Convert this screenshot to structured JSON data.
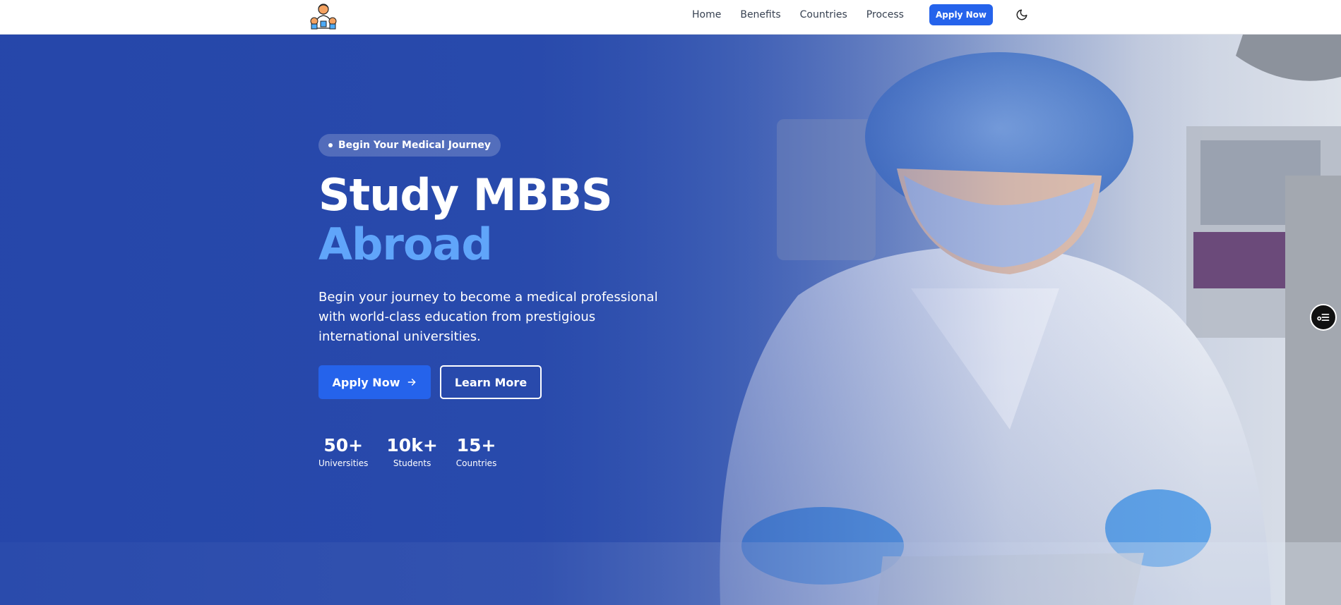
{
  "nav": {
    "logo_icon": "doctor-mascot-logo-icon",
    "links": [
      "Home",
      "Benefits",
      "Countries",
      "Process"
    ],
    "cta_label": "Apply Now",
    "theme_icon": "moon-icon"
  },
  "hero": {
    "badge_text": "Begin Your Medical Journey",
    "title_line1": "Study MBBS",
    "title_line2": "Abroad",
    "description": "Begin your journey to become a medical professional with world-class education from prestigious international universities.",
    "primary_button": "Apply Now",
    "primary_button_icon": "arrow-right-icon",
    "secondary_button": "Learn More",
    "stats": [
      {
        "value": "50+",
        "label": "Universities"
      },
      {
        "value": "10k+",
        "label": "Students"
      },
      {
        "value": "15+",
        "label": "Countries"
      }
    ],
    "background_image": "lab-researcher-photo"
  },
  "floating_widget_icon": "accessibility-menu-icon",
  "colors": {
    "brand_blue": "#2563eb",
    "accent_blue": "#60a5fa",
    "overlay_blue": "#2546aa"
  }
}
